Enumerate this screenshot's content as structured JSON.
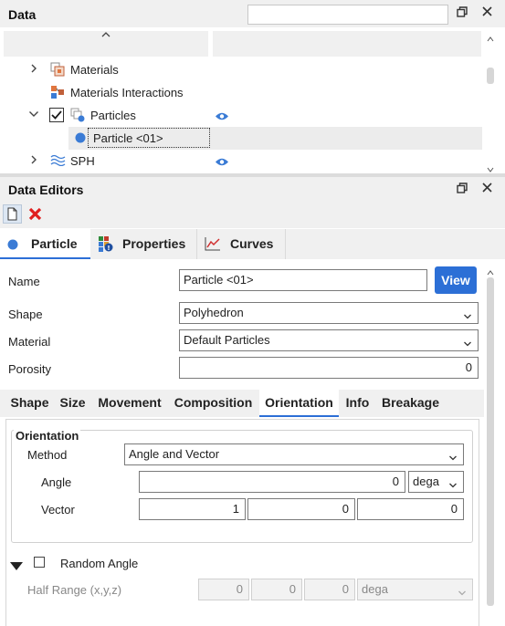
{
  "data_panel": {
    "title": "Data",
    "search_placeholder": "",
    "tree_items": [
      {
        "label": "Materials",
        "icon": "materials-icon"
      },
      {
        "label": "Materials Interactions",
        "icon": "interactions-icon"
      },
      {
        "label": "Particles",
        "icon": "particles-icon"
      },
      {
        "label": "Particle <01>",
        "icon": "particle-dot-icon"
      },
      {
        "label": "SPH",
        "icon": "sph-icon"
      }
    ]
  },
  "editors_panel": {
    "title": "Data Editors",
    "tabs": [
      {
        "label": "Particle"
      },
      {
        "label": "Properties"
      },
      {
        "label": "Curves"
      }
    ],
    "name_label": "Name",
    "name_value": "Particle <01>",
    "view_button": "View",
    "shape_label": "Shape",
    "shape_value": "Polyhedron",
    "material_label": "Material",
    "material_value": "Default Particles",
    "porosity_label": "Porosity",
    "porosity_value": "0",
    "subtabs": [
      "Shape",
      "Size",
      "Movement",
      "Composition",
      "Orientation",
      "Info",
      "Breakage"
    ],
    "orientation": {
      "group_title": "Orientation",
      "method_label": "Method",
      "method_value": "Angle and Vector",
      "angle_label": "Angle",
      "angle_value": "0",
      "angle_unit": "dega",
      "vector_label": "Vector",
      "vector_values": [
        "1",
        "0",
        "0"
      ],
      "random_angle_label": "Random Angle",
      "half_range_label": "Half Range (x,y,z)",
      "half_range_values": [
        "0",
        "0",
        "0"
      ],
      "half_range_unit": "dega"
    }
  },
  "colors": {
    "accent": "#2c6fd6",
    "eye": "#3a7bd5",
    "close_red": "#e02020"
  }
}
